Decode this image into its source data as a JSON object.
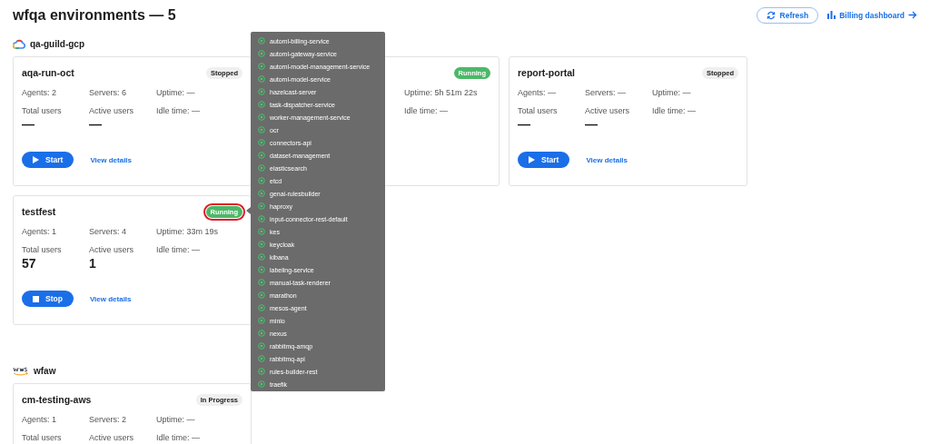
{
  "page": {
    "title": "wfqa environments — 5"
  },
  "header_actions": {
    "refresh": "Refresh",
    "billing": "Billing dashboard"
  },
  "groups": [
    {
      "name": "qa-guild-gcp",
      "kind": "gcp",
      "environments": [
        {
          "name": "aqa-run-oct",
          "status": {
            "label": "Stopped",
            "kind": "stopped",
            "highlighted": false
          },
          "agents": "Agents: 2",
          "servers": "Servers: 6",
          "uptime": "Uptime: —",
          "total_users_label": "Total users",
          "total_users": "—",
          "active_users_label": "Active users",
          "active_users": "—",
          "idle": "Idle time: —",
          "action": {
            "kind": "start",
            "label": "Start"
          },
          "details": "View details"
        },
        {
          "status": {
            "label": "Running",
            "kind": "running",
            "highlighted": false
          },
          "uptime": "Uptime: 5h 51m 22s",
          "idle": "Idle time: —"
        },
        {
          "name": "report-portal",
          "status": {
            "label": "Stopped",
            "kind": "stopped",
            "highlighted": false
          },
          "agents": "Agents: —",
          "servers": "Servers: —",
          "uptime": "Uptime: —",
          "total_users_label": "Total users",
          "total_users": "—",
          "active_users_label": "Active users",
          "active_users": "—",
          "idle": "Idle time: —",
          "action": {
            "kind": "start",
            "label": "Start"
          },
          "details": "View details"
        },
        {
          "name": "testfest",
          "status": {
            "label": "Running",
            "kind": "running",
            "highlighted": true
          },
          "agents": "Agents: 1",
          "servers": "Servers: 4",
          "uptime": "Uptime: 33m 19s",
          "total_users_label": "Total users",
          "total_users": "57",
          "active_users_label": "Active users",
          "active_users": "1",
          "idle": "Idle time: —",
          "action": {
            "kind": "stop",
            "label": "Stop"
          },
          "details": "View details"
        }
      ]
    },
    {
      "name": "wfaw",
      "kind": "aws",
      "environments": [
        {
          "name": "cm-testing-aws",
          "status": {
            "label": "In Progress",
            "kind": "in_progress",
            "highlighted": false
          },
          "agents": "Agents: 1",
          "servers": "Servers: 2",
          "uptime": "Uptime: —",
          "total_users_label": "Total users",
          "active_users_label": "Active users",
          "idle": "Idle time: —"
        }
      ]
    }
  ],
  "services_tooltip": {
    "items": [
      "automl-billing-service",
      "automl-gateway-service",
      "automl-model-management-service",
      "automl-model-service",
      "hazelcast-server",
      "task-dispatcher-service",
      "worker-management-service",
      "ocr",
      "connectors-api",
      "dataset-management",
      "elasticsearch",
      "etcd",
      "genai-rulesbuilder",
      "haproxy",
      "input-connector-rest-default",
      "kes",
      "keycloak",
      "kibana",
      "labeling-service",
      "manual-task-renderer",
      "marathon",
      "mesos-agent",
      "minio",
      "nexus",
      "rabbitmq-amqp",
      "rabbitmq-api",
      "rules-builder-rest",
      "traefik"
    ]
  }
}
